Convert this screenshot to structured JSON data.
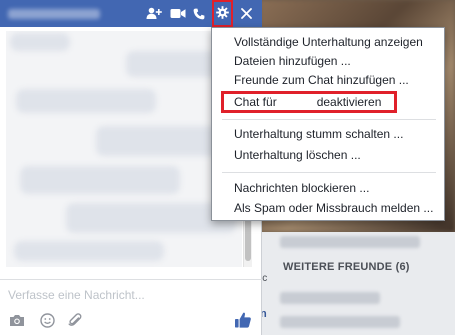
{
  "chat": {
    "header_icons": [
      "add-person-icon",
      "video-camera-icon",
      "phone-icon",
      "gear-icon",
      "close-icon"
    ],
    "composer_placeholder": "Verfasse eine Nachricht...",
    "toolbar_icons": [
      "camera-icon",
      "emoji-icon",
      "attachment-icon",
      "thumbs-up-icon"
    ]
  },
  "menu": {
    "items": [
      {
        "label": "Vollständige Unterhaltung anzeigen"
      },
      {
        "label": "Dateien hinzufügen ..."
      },
      {
        "label": "Freunde zum Chat hinzufügen ..."
      },
      {
        "label_before": "Chat für",
        "label_after": "deaktivieren",
        "highlighted": true
      },
      {
        "label": "Unterhaltung stumm schalten ..."
      },
      {
        "label": "Unterhaltung löschen ..."
      },
      {
        "label": "Nachrichten blockieren ..."
      },
      {
        "label": "Als Spam oder Missbrauch melden ..."
      }
    ]
  },
  "sidebar": {
    "section_title": "WEITERE FREUNDE (6)",
    "edge_text_1": "ic",
    "edge_text_2": "n"
  },
  "colors": {
    "header_blue": "#4267b2",
    "highlight_red": "#e0202a",
    "like_blue": "#4267b2"
  }
}
